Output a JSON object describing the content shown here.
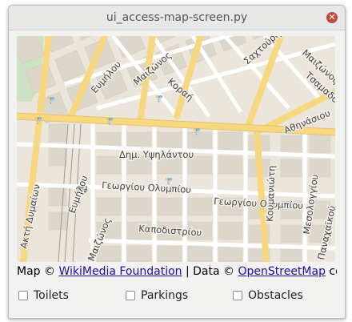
{
  "window": {
    "title": "ui_access-map-screen.py"
  },
  "map": {
    "streets": [
      {
        "label": "Ευμήλου"
      },
      {
        "label": "Μαιζώνος"
      },
      {
        "label": "Κοραή"
      },
      {
        "label": "Σαχτούρη"
      },
      {
        "label": "Μαιζώνος"
      },
      {
        "label": "Τσαμαδού"
      },
      {
        "label": "Αθηνάσιου"
      },
      {
        "label": "Δημ. Υψηλάντου"
      },
      {
        "label": "Γεωργίου Ολυμπίου"
      },
      {
        "label": "Γεωργίου Ολυμπίου"
      },
      {
        "label": "Κουμανιώτη"
      },
      {
        "label": "Μεσολογγίου"
      },
      {
        "label": "Ευμήλου"
      },
      {
        "label": "Ακτή Δυμαίων"
      },
      {
        "label": "Μαιζώνος"
      },
      {
        "label": "Καποδιστρίου"
      },
      {
        "label": "Παναχαϊκού"
      }
    ]
  },
  "attribution": {
    "prefix": "Map © ",
    "map_link": "WikiMedia Foundation",
    "middle": " | Data © ",
    "data_link": "OpenStreetMap",
    "suffix": " cont"
  },
  "filters": [
    {
      "label": "Toilets",
      "checked": false
    },
    {
      "label": "Parkings",
      "checked": false
    },
    {
      "label": "Obstacles",
      "checked": false
    }
  ]
}
